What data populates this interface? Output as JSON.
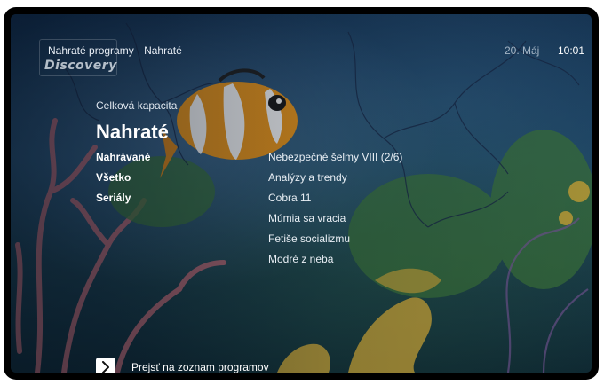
{
  "header": {
    "breadcrumb": [
      "Nahraté programy",
      "Nahraté"
    ],
    "logo_text": "Discovery",
    "date": "20. Máj",
    "time": "10:01"
  },
  "main": {
    "capacity_label": "Celková kapacita",
    "title": "Nahraté",
    "categories": [
      {
        "label": "Nahrávané"
      },
      {
        "label": "Všetko"
      },
      {
        "label": "Seriály"
      }
    ],
    "programs": [
      {
        "label": "Nebezpečné šelmy VIII (2/6)"
      },
      {
        "label": "Analýzy a trendy"
      },
      {
        "label": "Cobra 11"
      },
      {
        "label": "Múmia sa vracia"
      },
      {
        "label": "Fetiše socializmu"
      },
      {
        "label": "Modré z neba"
      }
    ]
  },
  "footer": {
    "action_icon": "chevron-right-icon",
    "action_label": "Prejsť na zoznam programov"
  }
}
